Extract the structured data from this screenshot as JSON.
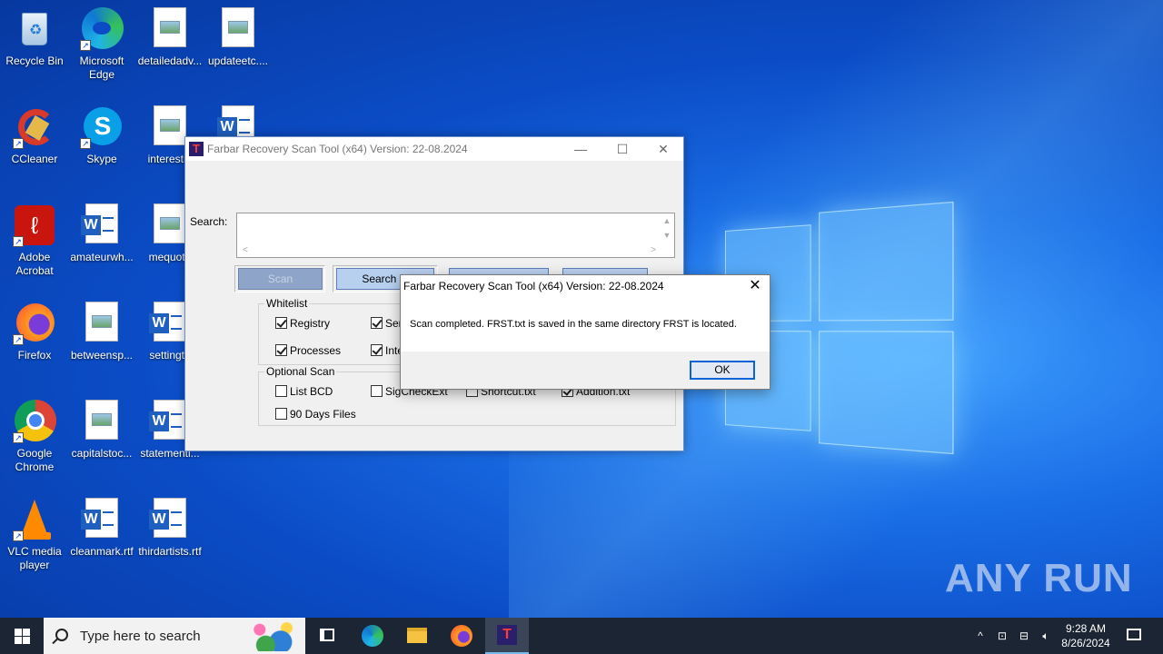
{
  "desktop": {
    "icons": [
      {
        "label": "Recycle Bin"
      },
      {
        "label": "Microsoft Edge"
      },
      {
        "label": "detailedadv..."
      },
      {
        "label": "updateetc...."
      },
      {
        "label": "CCleaner"
      },
      {
        "label": "Skype"
      },
      {
        "label": "interestin"
      },
      {
        "label": "Adobe Acrobat"
      },
      {
        "label": "amateurwh..."
      },
      {
        "label": "mequote"
      },
      {
        "label": "Firefox"
      },
      {
        "label": "betweensp..."
      },
      {
        "label": "settingtu"
      },
      {
        "label": "Google Chrome"
      },
      {
        "label": "capitalstoc..."
      },
      {
        "label": "statementi..."
      },
      {
        "label": "VLC media player"
      },
      {
        "label": "cleanmark.rtf"
      },
      {
        "label": "thirdartists.rtf"
      }
    ],
    "watermark": "ANY RUN"
  },
  "frst": {
    "title": "Farbar Recovery Scan Tool (x64) Version: 22-08.2024",
    "search_label": "Search:",
    "search_value": "",
    "buttons": {
      "scan": "Scan",
      "search_files": "Search Fi"
    },
    "whitelist": {
      "label": "Whitelist",
      "items": [
        {
          "label": "Registry",
          "checked": true
        },
        {
          "label": "Ser",
          "checked": true
        },
        {
          "label": "Processes",
          "checked": true
        },
        {
          "label": "Inte",
          "checked": true
        }
      ]
    },
    "optional_scan": {
      "label": "Optional Scan",
      "items": [
        {
          "label": "List BCD",
          "checked": false
        },
        {
          "label": "SigCheckExt",
          "checked": false
        },
        {
          "label": "Shortcut.txt",
          "checked": false
        },
        {
          "label": "Addition.txt",
          "checked": true
        },
        {
          "label": "90 Days Files",
          "checked": false
        }
      ]
    }
  },
  "dialog": {
    "title": "Farbar Recovery Scan Tool (x64) Version: 22-08.2024",
    "message": "Scan completed. FRST.txt is saved in the same directory FRST is located.",
    "ok": "OK"
  },
  "taskbar": {
    "search_placeholder": "Type here to search",
    "time": "9:28 AM",
    "date": "8/26/2024"
  }
}
